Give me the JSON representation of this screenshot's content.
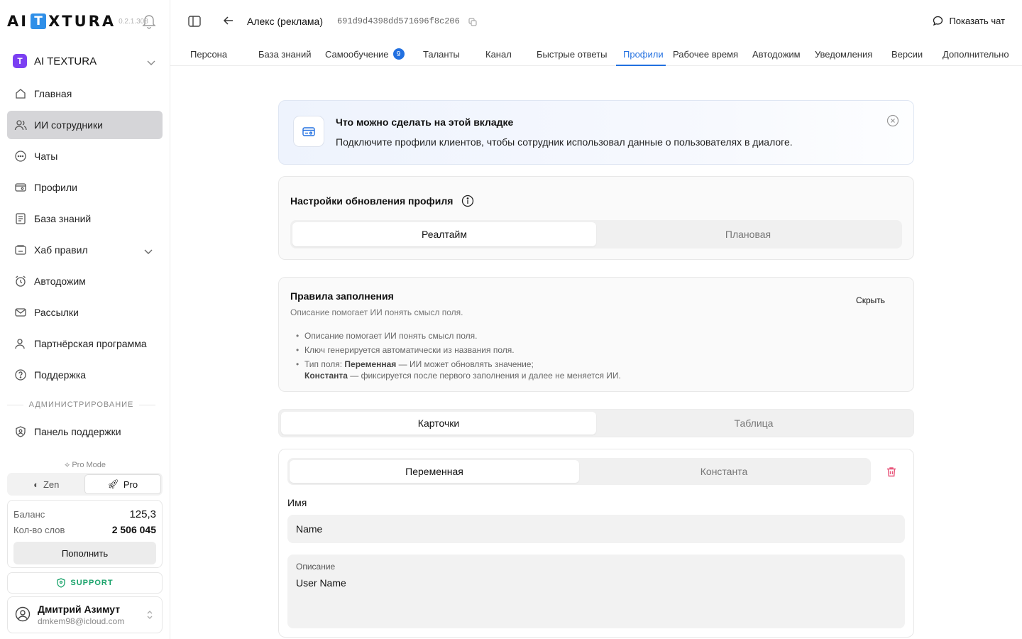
{
  "brand": {
    "logo_pre": "AI",
    "logo_t": "T",
    "logo_post": "XTURA",
    "version": "0.2.1.308"
  },
  "workspace": {
    "badge": "T",
    "name": "AI TEXTURA"
  },
  "nav": {
    "items": [
      {
        "label": "Главная",
        "icon": "home-icon"
      },
      {
        "label": "ИИ сотрудники",
        "icon": "users-icon"
      },
      {
        "label": "Чаты",
        "icon": "chat-icon"
      },
      {
        "label": "Профили",
        "icon": "profile-card-icon"
      },
      {
        "label": "База знаний",
        "icon": "book-icon"
      },
      {
        "label": "Хаб правил",
        "icon": "rules-hub-icon"
      },
      {
        "label": "Автодожим",
        "icon": "alarm-icon"
      },
      {
        "label": "Рассылки",
        "icon": "mail-icon"
      },
      {
        "label": "Партнёрская программа",
        "icon": "partner-icon"
      },
      {
        "label": "Поддержка",
        "icon": "help-icon"
      }
    ],
    "admin_title": "АДМИНИСТРИРОВАНИЕ",
    "admin_item": "Панель поддержки"
  },
  "mode": {
    "label": "Pro Mode",
    "zen": "Zen",
    "pro": "Pro",
    "selected": "Pro"
  },
  "balance": {
    "balance_label": "Баланс",
    "balance_value": "125,3",
    "words_label": "Кол-во слов",
    "words_value": "2 506 045",
    "topup_label": "Пополнить"
  },
  "support_label": "SUPPORT",
  "user": {
    "name": "Дмитрий Азимут",
    "email": "dmkem98@icloud.com"
  },
  "header": {
    "title": "Алекс (реклама)",
    "id": "691d9d4398dd571696f8c206",
    "show_chat": "Показать чат"
  },
  "tabs": [
    {
      "label": "Персона"
    },
    {
      "label": "База знаний"
    },
    {
      "label": "Самообучение",
      "count": "9"
    },
    {
      "label": "Таланты"
    },
    {
      "label": "Канал"
    },
    {
      "label": "Быстрые ответы"
    },
    {
      "label": "Профили"
    },
    {
      "label": "Рабочее время"
    },
    {
      "label": "Автодожим"
    },
    {
      "label": "Уведомления"
    },
    {
      "label": "Версии"
    },
    {
      "label": "Дополнительно"
    }
  ],
  "active_tab": "Профили",
  "info": {
    "title": "Что можно сделать на этой вкладке",
    "text": "Подключите профили клиентов, чтобы сотрудник использовал данные о пользователях в диалоге."
  },
  "update_settings": {
    "title": "Настройки обновления профиля",
    "options": [
      "Реалтайм",
      "Плановая"
    ],
    "selected": "Реалтайм"
  },
  "rules": {
    "title": "Правила заполнения",
    "subtitle": "Описание помогает ИИ понять смысл поля.",
    "hide_label": "Скрыть",
    "item1": "Описание помогает ИИ понять смысл поля.",
    "item2": "Ключ генерируется автоматически из названия поля.",
    "item3_prefix": "Тип поля: ",
    "item3_bold1": "Переменная",
    "item3_mid": " — ИИ может обновлять значение;",
    "item3_bold2": "Константа",
    "item3_suffix": " — фиксируется после первого заполнения и далее не меняется ИИ."
  },
  "view": {
    "options": [
      "Карточки",
      "Таблица"
    ],
    "selected": "Карточки"
  },
  "field_card": {
    "type_options": [
      "Переменная",
      "Константа"
    ],
    "type_selected": "Переменная",
    "name_label": "Имя",
    "name_value": "Name",
    "desc_label": "Описание",
    "desc_value": "User Name"
  },
  "colors": {
    "accent": "#2270e0",
    "brand_purple": "#7b3ff2",
    "support_green": "#1aa36b",
    "danger": "#e8557a"
  }
}
